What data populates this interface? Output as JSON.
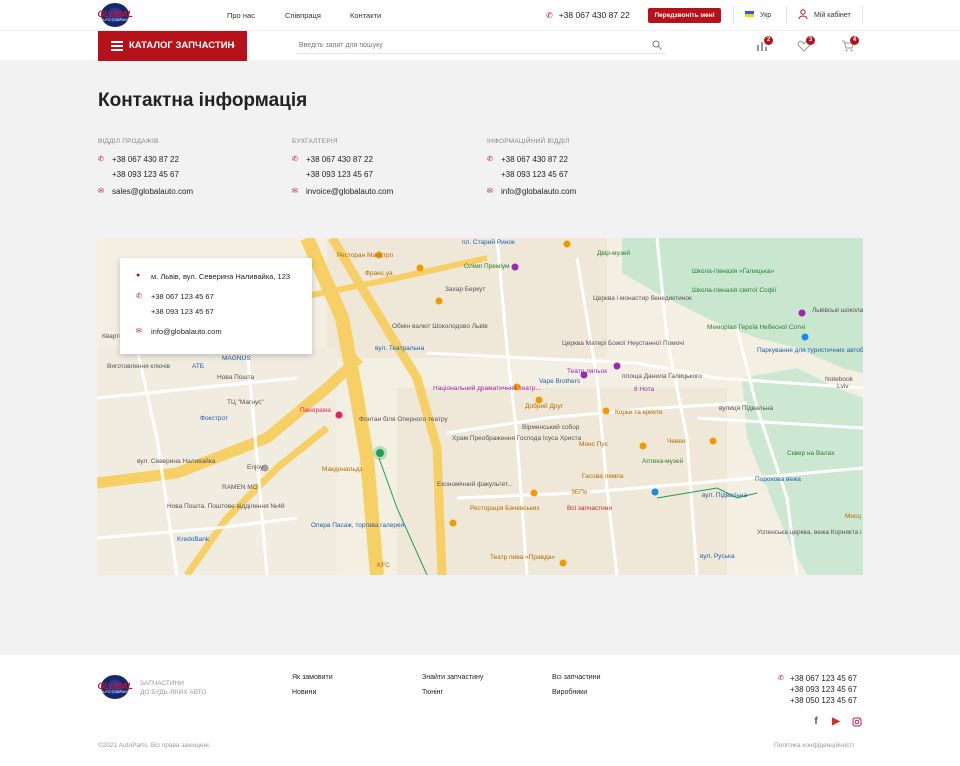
{
  "header": {
    "logo_text": "GLOBAL",
    "logo_sub": "AUTO COMPANY",
    "nav": [
      "Про нас",
      "Співпраця",
      "Контакти"
    ],
    "phone": "+38  067 430 87 22",
    "callback_label": "Передзвоніть мені",
    "language": "Укр",
    "cabinet_label": "Мій кабінет"
  },
  "search_bar": {
    "catalog_label": "КАТАЛОГ ЗАПЧАСТИН",
    "search_placeholder": "Введіть запит для пошуку",
    "compare_count": "2",
    "favorites_count": "3",
    "cart_count": "4"
  },
  "page": {
    "title": "Контактна інформація",
    "columns": [
      {
        "heading": "ВІДДІЛ ПРОДАЖІВ",
        "phone1": "+38  067 430 87 22",
        "phone2": "+38 093 123 45 67",
        "email": "sales@globalauto.com"
      },
      {
        "heading": "БУХГАЛТЕРІЯ",
        "phone1": "+38  067 430 87 22",
        "phone2": "+38 093 123 45 67",
        "email": "invoice@globalauto.com"
      },
      {
        "heading": "ІНФОРМАЦІЙНИЙ ВІДДІЛ",
        "phone1": "+38  067 430 87 22",
        "phone2": "+38 093 123 45 67",
        "email": "info@globalauto.com"
      }
    ]
  },
  "map": {
    "card": {
      "address": "м. Львів, вул. Северина Наливайка, 123",
      "phone1": "+38 067 123 45 67",
      "phone2": "+38 093 123 45 67",
      "email": "info@globalauto.com"
    },
    "labels": {
      "l1": "пл. Старий Ринок",
      "l2": "Ресторан Маестро",
      "l3": "Франс.уа",
      "l4": "Олімп Преміум",
      "l5": "Двір-музей",
      "l6": "Школа-гімназія «Галицька»",
      "l7": "Захар Беркут",
      "l8": "Церква і монастир бенедиктинок",
      "l9": "Школа-гімназія святої Софії",
      "l10": "Меморіал Героїв Небесної Сотні",
      "l11": "Львівські шоколадні",
      "l12": "Обмін валют Шоколодово Львів",
      "l13": "вул. Театральна",
      "l14": "Церква Матері Божої Неустанної Помочі",
      "l15": "Паркування для туристичних автобусів",
      "l16": "Театр ляльок",
      "l17": "площа Данила Галицького",
      "l18": "Vape Brothers",
      "l19": "8 Нота",
      "l20": "Національний драматичний театр...",
      "l21": "Добрий Друг",
      "l22": "Корки та крихти",
      "l23": "Вірменський собор",
      "l24": "Чевен",
      "l25": "Храм Преображення Господа Ісуса Христа",
      "l26": "Монс Пус",
      "l27": "Аптека-музей",
      "l28": "Сквер на Валах",
      "l29": "Фонтан біля Оперного театру",
      "l30": "Панорама",
      "l31": "Макдональдз",
      "l32": "ТЦ \"Магнус\"",
      "l33": "Фокстрот",
      "l34": "Вигот­овлення ключів",
      "l35": "АТБ",
      "l36": "Нова Пошта",
      "l37": "вул. Северина Наливайка",
      "l38": "RAMEN MO",
      "l39": "Enjoy",
      "l40": "Нова Пошта. Поштове відділення №48",
      "l41": "KredoBank",
      "l42": "Опера Пасаж, торгова галерея",
      "l43": "Ресторація Бачевських",
      "l44": "Всі запчастини",
      "l45": "Гасова лямпа",
      "l46": "ЗБПо",
      "l47": "Економічний факультет...",
      "l48": "вул. Підвальна",
      "l49": "Порохова вежа",
      "l50": "Театр пива «Правда»",
      "l51": "вул. Руська",
      "l52": "Успенська церква, вежа Корнякта і капличка...",
      "l53": "KFC",
      "l54": "Notebook",
      "l55": "вулиця Підвальна",
      "l56": "MAGNUS",
      "l57": "Кварти",
      "l58": "Lviv",
      "l59": "Мисц"
    }
  },
  "footer": {
    "tagline1": "ЗАПЧАСТИНИ",
    "tagline2": "ДО БУДЬ-ЯКИХ АВТО",
    "links": [
      "Як замовити",
      "Новини",
      "Знайти запчастину",
      "Тюнінг",
      "Всі запчастини",
      "Виробники"
    ],
    "phone1": "+38  067 123 45 67",
    "phone2": "+38  093 123 45 67",
    "phone3": "+38  050 123 45 67",
    "copyright": "©2021 AutoParts. Всі права захищені.",
    "privacy": "Політика конфіденційності"
  },
  "colors": {
    "accent": "#b5121b",
    "brand_blue": "#1e3b8f"
  }
}
